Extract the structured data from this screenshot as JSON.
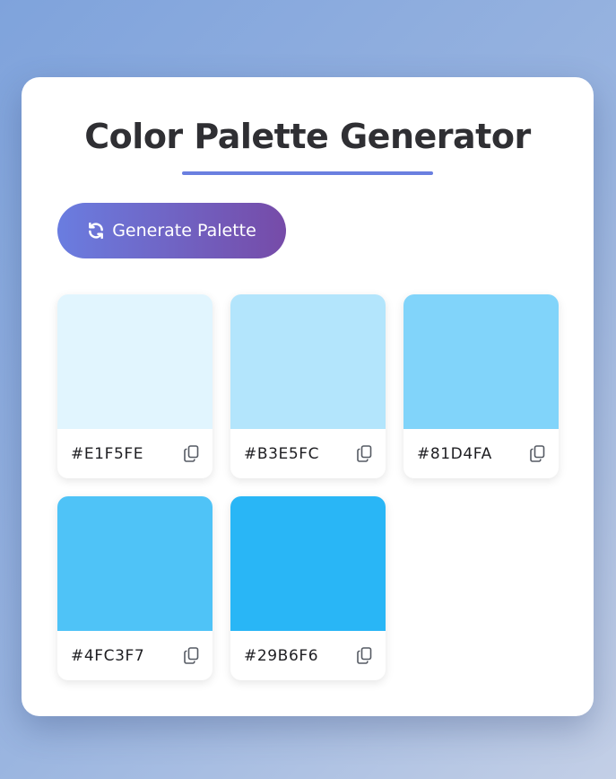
{
  "app": {
    "title": "Color Palette Generator"
  },
  "generate_button": {
    "label": "Generate Palette",
    "icon": "sync-icon"
  },
  "palette": [
    {
      "hex": "#E1F5FE",
      "color": "#E1F5FE",
      "copy_icon": "copy-icon"
    },
    {
      "hex": "#B3E5FC",
      "color": "#B3E5FC",
      "copy_icon": "copy-icon"
    },
    {
      "hex": "#81D4FA",
      "color": "#81D4FA",
      "copy_icon": "copy-icon"
    },
    {
      "hex": "#4FC3F7",
      "color": "#4FC3F7",
      "copy_icon": "copy-icon"
    },
    {
      "hex": "#29B6F6",
      "color": "#29B6F6",
      "copy_icon": "copy-icon"
    }
  ],
  "colors": {
    "accent_start": "#6a7de0",
    "accent_end": "#764ba8",
    "title_text": "#2f2f33"
  }
}
